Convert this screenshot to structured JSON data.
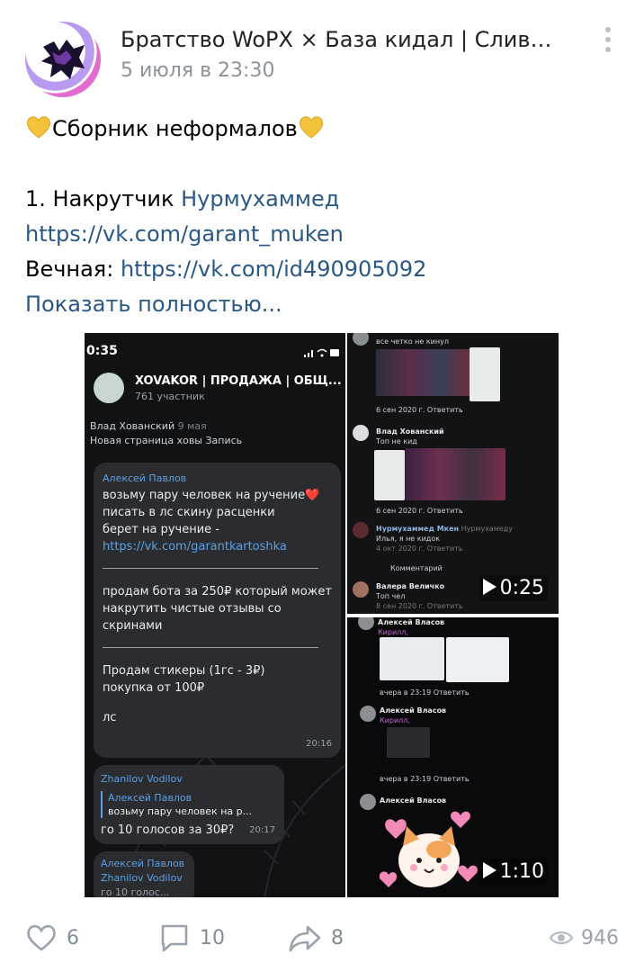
{
  "post": {
    "author": "Братство WoPX × База кидал | Слив мо...",
    "date": "5 июля в 23:30",
    "title_line": "Сборник неформалов",
    "line1_prefix": "1. Накрутчик ",
    "line1_link": "Нурмухаммед",
    "line2_link": "https://vk.com/garant_muken",
    "line3_prefix": "Вечная: ",
    "line3_link": "https://vk.com/id490905092",
    "show_more": "Показать полностью..."
  },
  "screenshot_chat": {
    "status_time": "0:35",
    "chat_name": "XOVAKOR | ПРОДАЖА | ОБЩ...",
    "chat_members": "761 участник",
    "top_author": "Влад Хованский",
    "top_date": "9 мая",
    "top_text": "Новая страница ховы Запись",
    "bubble1_sender": "Алексей Павлов",
    "bubble1_line1": "возьму пару человек на ручение❤️",
    "bubble1_line2": "писать в лс скину расценки",
    "bubble1_line3": "берет на ручение - ",
    "bubble1_link": "https://vk.com/garantkartoshka",
    "bubble1_line4": "продам бота за 250₽ который может накрутить чистые отзывы со скринами",
    "bubble1_line5": "Продам стикеры (1гс - 3₽)",
    "bubble1_line6": "покупка от 100₽",
    "bubble1_line7": "лс",
    "bubble1_time": "20:16",
    "bubble2_sender": "Zhanilov Vodilov",
    "bubble2_quote_name": "Алексей Павлов",
    "bubble2_quote_text": "возьму пару человек на р...",
    "bubble2_text": "го 10 голосов за 30₽?",
    "bubble2_time": "20:17",
    "bubble3_sender": "Алексей Павлов",
    "bubble3_quote_name": "Zhanilov Vodilov",
    "bubble3_quote_text": "го 10 голос..."
  },
  "video1": {
    "duration": "0:25",
    "row1_text": "все четко не кинул",
    "row1_meta": "6 сен 2020 г.  Ответить",
    "row2_name": "Влад Хованский",
    "row2_text": "Топ не кид",
    "row2_meta": "6 сен 2020 г.  Ответить",
    "row3_name": "Нурмухаммед Мкен",
    "row3_extra": "Нурмухамеду",
    "row3_text": "Илья, я не кидок",
    "row3_meta": "4 окт 2020 г.  Ответить",
    "comment_placeholder": "Комментарий",
    "row4_name": "Валера Величко",
    "row4_text": "Топ чел",
    "row4_meta": "8 сен 2020 г.  Ответить"
  },
  "video2": {
    "duration": "1:10",
    "row1_name": "Алексей Власов",
    "row1_text": "Кирилл,",
    "row1_meta": "вчера в 23:19  Ответить",
    "row2_name": "Алексей Власов",
    "row2_text": "Кирилл,",
    "row2_meta": "вчера в 23:19  Ответить",
    "row3_name": "Алексей Власов"
  },
  "footer": {
    "likes": "6",
    "comments": "10",
    "shares": "8",
    "views": "946"
  },
  "colors": {
    "link": "#2a5885",
    "meta": "#8d9399",
    "icon": "#818c99"
  }
}
